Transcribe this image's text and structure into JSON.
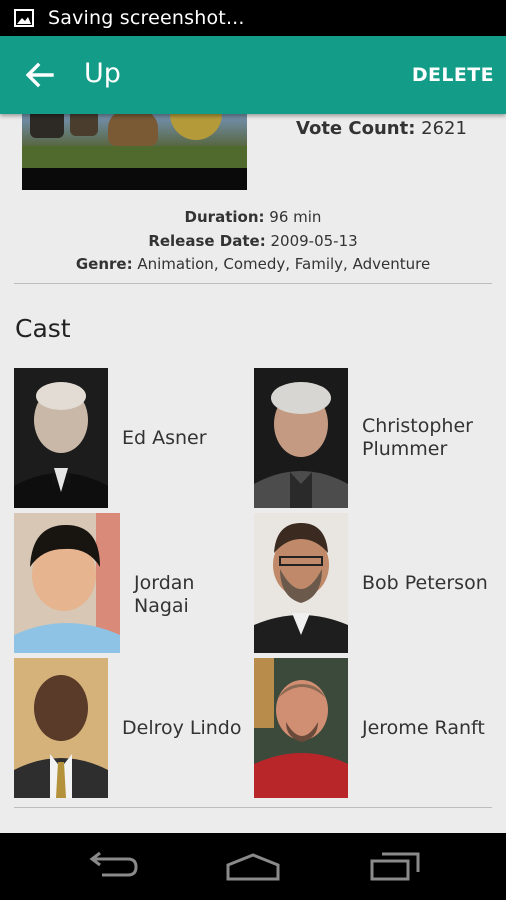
{
  "status_bar": {
    "text": "Saving screenshot..."
  },
  "app_bar": {
    "title": "Up",
    "delete_label": "DELETE"
  },
  "movie": {
    "vote_count_label": "Vote Count:",
    "vote_count": "2621",
    "duration_label": "Duration:",
    "duration": "96 min",
    "release_label": "Release Date:",
    "release_date": "2009-05-13",
    "genre_label": "Genre:",
    "genres": "Animation, Comedy, Family, Adventure"
  },
  "cast": {
    "title": "Cast",
    "members": [
      {
        "name": "Ed Asner"
      },
      {
        "name": "Christopher Plummer"
      },
      {
        "name": "Jordan Nagai"
      },
      {
        "name": "Bob Peterson"
      },
      {
        "name": "Delroy Lindo"
      },
      {
        "name": "Jerome Ranft"
      }
    ]
  },
  "icons": {
    "status": "image-icon",
    "back": "arrow-back-icon",
    "nav_back": "nav-back-icon",
    "nav_home": "nav-home-icon",
    "nav_recents": "nav-recents-icon"
  },
  "colors": {
    "accent": "#139c87",
    "background": "#ececec"
  }
}
